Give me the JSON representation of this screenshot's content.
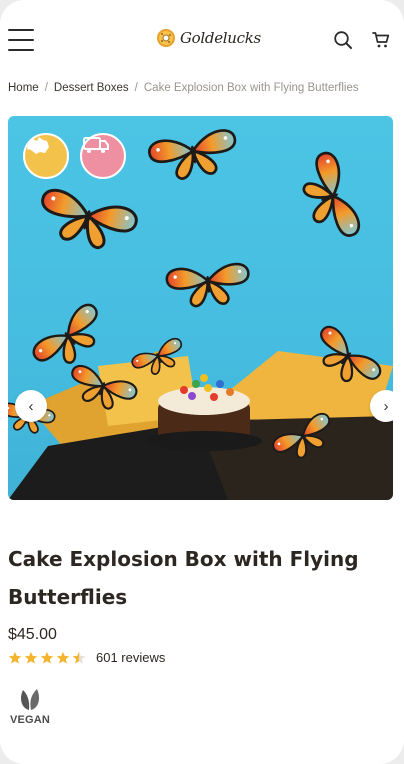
{
  "header": {
    "brand_name": "Goldelucks",
    "icons": [
      "hamburger-menu-icon",
      "donut-logo-icon",
      "search-icon",
      "cart-icon"
    ]
  },
  "breadcrumb": {
    "items": [
      "Home",
      "Dessert Boxes",
      "Cake Explosion Box with Flying Butterflies"
    ],
    "separator": "/"
  },
  "gallery": {
    "badges": [
      "australia-map-icon",
      "delivery-van-icon"
    ],
    "prev_icon": "‹",
    "next_icon": "›",
    "background_color": "#47bfe1"
  },
  "product": {
    "title": "Cake Explosion Box with Flying Butterflies",
    "price": "$45.00",
    "rating": 4.5,
    "reviews": "601 reviews",
    "dietary": {
      "label": "VEGAN",
      "icon": "leaf-icon"
    }
  },
  "colors": {
    "star": "#f3b72f",
    "text": "#2d2721",
    "muted": "#9a948e"
  }
}
